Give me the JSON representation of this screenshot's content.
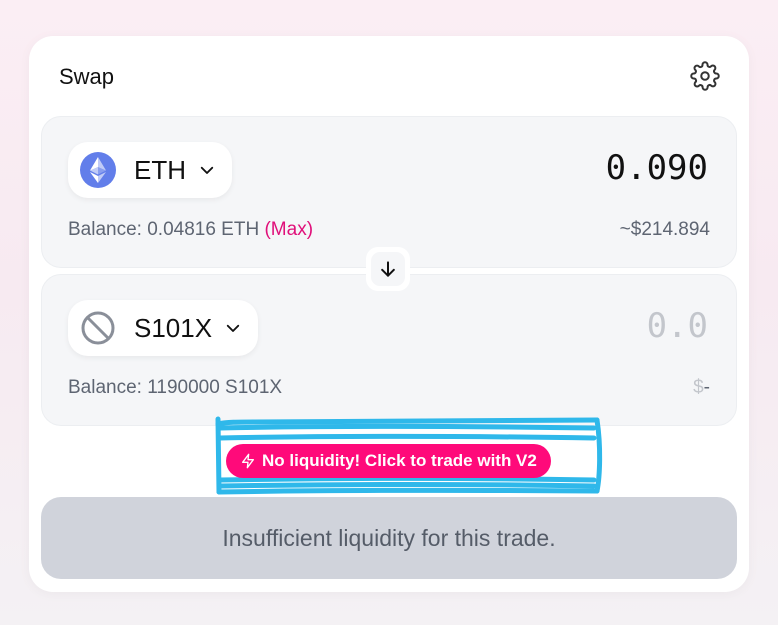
{
  "swap": {
    "title": "Swap",
    "settings_icon": "gear-icon",
    "from": {
      "token_symbol": "ETH",
      "token_icon": "ethereum-icon",
      "amount": "0.090",
      "balance_text": "Balance: 0.04816 ETH ",
      "max_label": "(Max)",
      "usd_value": "~$214.894"
    },
    "to": {
      "token_symbol": "S101X",
      "token_icon": "no-token-icon",
      "amount_placeholder": "0.0",
      "balance_text": "Balance: 1190000 S101X",
      "usd_sign": "$",
      "usd_value": "-"
    },
    "switch_icon": "arrow-down-icon",
    "v2_prompt": {
      "icon": "lightning-icon",
      "label": "No liquidity! Click to trade with V2"
    },
    "submit_label": "Insufficient liquidity for this trade."
  },
  "colors": {
    "accent_pink": "#ff0a7a",
    "max_pink": "#e0107a",
    "annotation_blue": "#2fb8ea",
    "disabled_button": "#d0d3db",
    "eth_blue": "#627eea"
  }
}
